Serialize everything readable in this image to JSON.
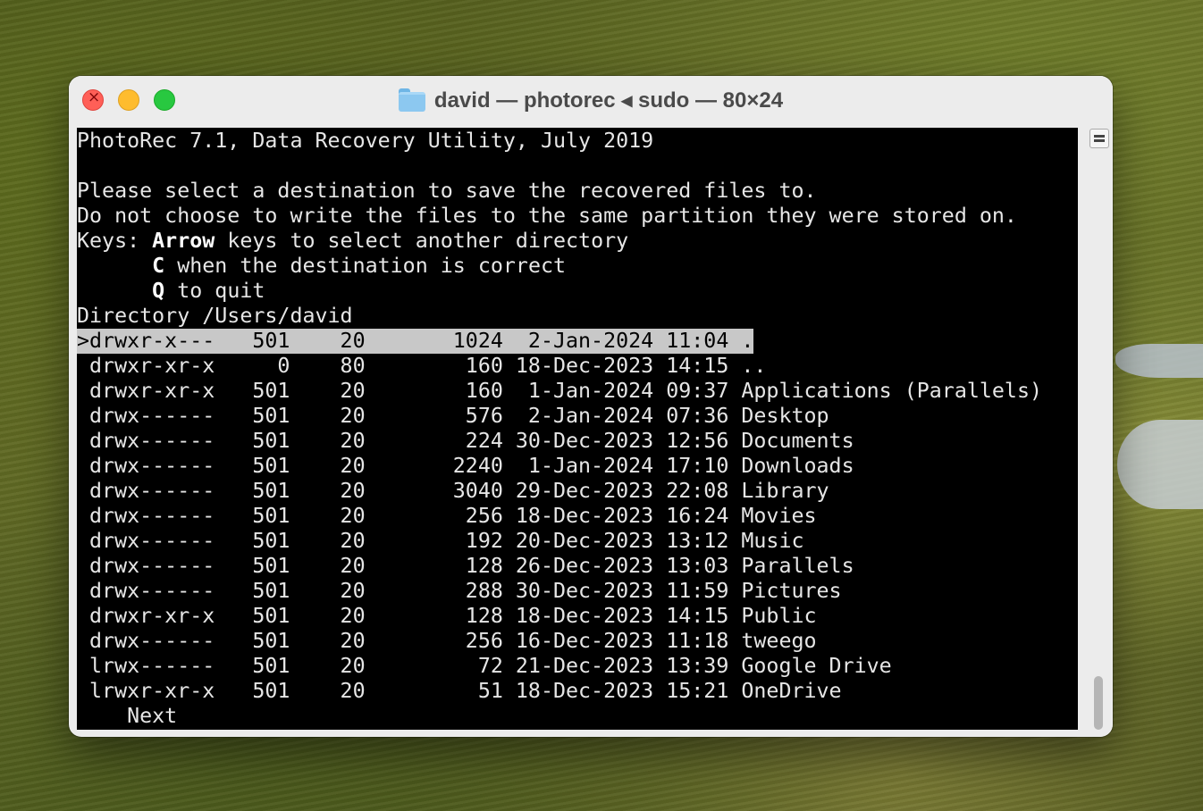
{
  "window": {
    "title": "david — photorec ◂ sudo — 80×24",
    "folder_icon": "folder-icon"
  },
  "terminal": {
    "header_line": "PhotoRec 7.1, Data Recovery Utility, July 2019",
    "instructions": [
      "Please select a destination to save the recovered files to.",
      "Do not choose to write the files to the same partition they were stored on."
    ],
    "keys": {
      "label": "Keys: ",
      "arrow_key": "Arrow",
      "arrow_text": " keys to select another directory",
      "c_indent": "      ",
      "c_key": "C",
      "c_text": " when the destination is correct",
      "q_indent": "      ",
      "q_key": "Q",
      "q_text": " to quit"
    },
    "directory_line": "Directory /Users/david",
    "selected_entry": ">drwxr-x---   501    20       1024  2-Jan-2024 11:04 .",
    "entries": [
      " drwxr-xr-x     0    80        160 18-Dec-2023 14:15 ..",
      " drwxr-xr-x   501    20        160  1-Jan-2024 09:37 Applications (Parallels)",
      " drwx------   501    20        576  2-Jan-2024 07:36 Desktop",
      " drwx------   501    20        224 30-Dec-2023 12:56 Documents",
      " drwx------   501    20       2240  1-Jan-2024 17:10 Downloads",
      " drwx------   501    20       3040 29-Dec-2023 22:08 Library",
      " drwx------   501    20        256 18-Dec-2023 16:24 Movies",
      " drwx------   501    20        192 20-Dec-2023 13:12 Music",
      " drwx------   501    20        128 26-Dec-2023 13:03 Parallels",
      " drwx------   501    20        288 30-Dec-2023 11:59 Pictures",
      " drwxr-xr-x   501    20        128 18-Dec-2023 14:15 Public",
      " drwx------   501    20        256 16-Dec-2023 11:18 tweego",
      " lrwx------   501    20         72 21-Dec-2023 13:39 Google Drive",
      " lrwxr-xr-x   501    20         51 18-Dec-2023 15:21 OneDrive"
    ],
    "next_label": "    Next"
  },
  "colors": {
    "terminal_bg": "#000000",
    "terminal_fg": "#e6e6e6",
    "selection_bg": "#c8c8c8",
    "close": "#ff5f57",
    "minimize": "#febc2e",
    "maximize": "#28c840"
  }
}
